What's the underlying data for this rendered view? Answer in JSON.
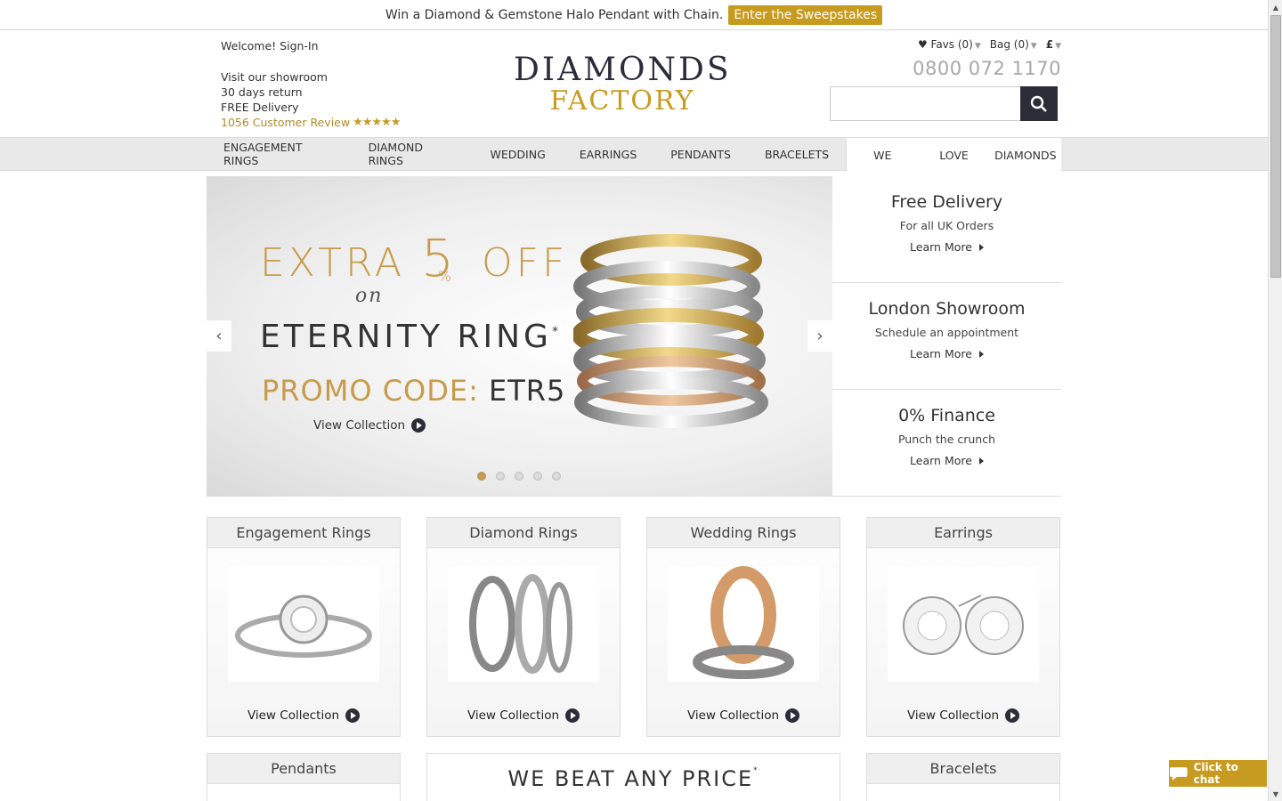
{
  "promo_bar": {
    "text": "Win a Diamond & Gemstone Halo Pendant with Chain.",
    "button": "Enter the Sweepstakes"
  },
  "header": {
    "welcome": "Welcome! Sign-In",
    "lines": [
      "Visit our showroom",
      "30 days return",
      "FREE Delivery"
    ],
    "review": "1056 Customer Review",
    "logo_top": "DIAMONDS",
    "logo_bottom": "FACTORY",
    "favs": "Favs (0)",
    "bag": "Bag (0)",
    "currency": "£",
    "phone": "0800 072 1170",
    "search_placeholder": ""
  },
  "nav": {
    "items": [
      "ENGAGEMENT RINGS",
      "DIAMOND RINGS",
      "WEDDING",
      "EARRINGS",
      "PENDANTS",
      "BRACELETS"
    ],
    "tagline": [
      "WE",
      "LOVE",
      "DIAMONDS"
    ]
  },
  "hero": {
    "line1a": "EXTRA",
    "line1b": "5",
    "line1c": "OFF",
    "percent": "%",
    "on": "on",
    "ring": "ETERNITY RING",
    "asterisk": "*",
    "promo_label": "PROMO CODE:",
    "promo_code": "ETR5",
    "cta": "View Collection",
    "slides": 5,
    "active_slide": 1
  },
  "side": [
    {
      "title": "Free Delivery",
      "sub": "For all UK Orders",
      "link": "Learn More"
    },
    {
      "title": "London Showroom",
      "sub": "Schedule an appointment",
      "link": "Learn More"
    },
    {
      "title": "0% Finance",
      "sub": "Punch the crunch",
      "link": "Learn More"
    }
  ],
  "categories": [
    {
      "title": "Engagement Rings",
      "cta": "View Collection"
    },
    {
      "title": "Diamond Rings",
      "cta": "View Collection"
    },
    {
      "title": "Wedding Rings",
      "cta": "View Collection"
    },
    {
      "title": "Earrings",
      "cta": "View Collection"
    }
  ],
  "row2": {
    "left": "Pendants",
    "center": "WE BEAT ANY PRICE",
    "center_mark": "*",
    "right": "Bracelets"
  },
  "chat": "Click to chat",
  "colors": {
    "gold": "#c79b1f",
    "dark": "#2d2d3a"
  }
}
